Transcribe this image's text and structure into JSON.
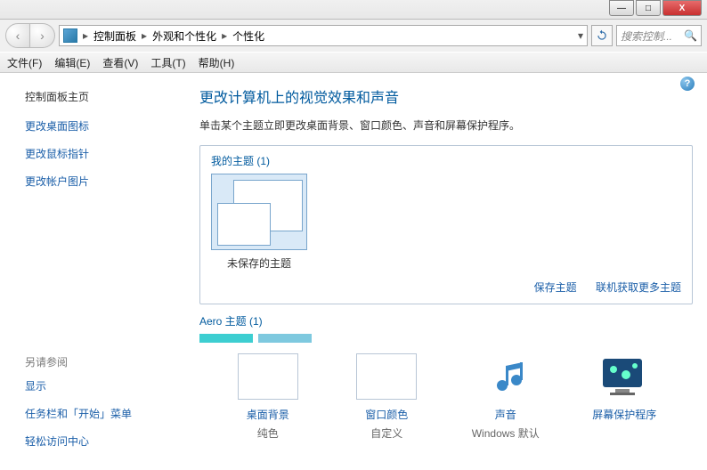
{
  "titlebar": {
    "minimize": "—",
    "maximize": "□",
    "close": "X"
  },
  "nav": {
    "back": "‹",
    "forward": "›"
  },
  "addressbar": {
    "sep": "▸",
    "segments": [
      "控制面板",
      "外观和个性化",
      "个性化"
    ],
    "dropdown": "▾",
    "refresh": "↻"
  },
  "search": {
    "placeholder": "搜索控制...",
    "icon": "🔍"
  },
  "menu": {
    "file": "文件(F)",
    "edit": "编辑(E)",
    "view": "查看(V)",
    "tools": "工具(T)",
    "help": "帮助(H)"
  },
  "sidebar": {
    "heading": "控制面板主页",
    "links": [
      "更改桌面图标",
      "更改鼠标指针",
      "更改帐户图片"
    ],
    "seealso_heading": "另请参阅",
    "seealso": [
      "显示",
      "任务栏和「开始」菜单",
      "轻松访问中心"
    ]
  },
  "main": {
    "help": "?",
    "title": "更改计算机上的视觉效果和声音",
    "subtitle": "单击某个主题立即更改桌面背景、窗口颜色、声音和屏幕保护程序。",
    "my_themes_label": "我的主题 (1)",
    "theme_name": "未保存的主题",
    "save_theme": "保存主题",
    "get_more": "联机获取更多主题",
    "aero_label": "Aero 主题 (1)"
  },
  "settings": [
    {
      "key": "desktop-background",
      "title": "桌面背景",
      "value": "纯色"
    },
    {
      "key": "window-color",
      "title": "窗口颜色",
      "value": "自定义"
    },
    {
      "key": "sound",
      "title": "声音",
      "value": "Windows 默认"
    },
    {
      "key": "screensaver",
      "title": "屏幕保护程序",
      "value": ""
    }
  ]
}
